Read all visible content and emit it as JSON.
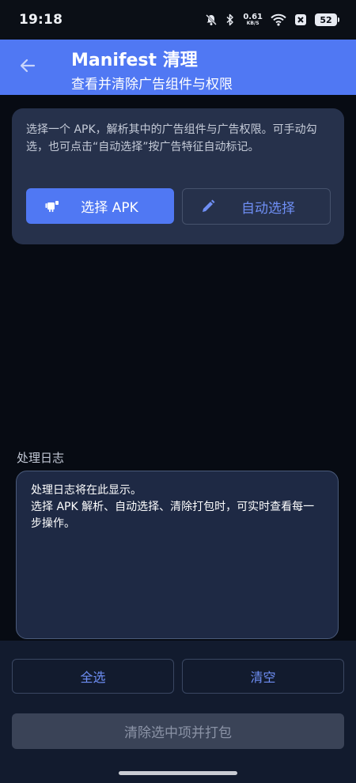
{
  "status_bar": {
    "time": "19:18",
    "net_speed_value": "0.61",
    "net_speed_unit": "KB/S",
    "battery_level": "52",
    "icons": [
      "bell-off-icon",
      "bluetooth-icon",
      "wifi-icon",
      "x-app-icon",
      "battery-icon"
    ]
  },
  "app_bar": {
    "back_icon": "arrow-left-icon",
    "title": "Manifest 清理",
    "subtitle": "查看并清除广告组件与权限"
  },
  "intro_card": {
    "description": "选择一个 APK，解析其中的广告组件与广告权限。可手动勾选，也可点击“自动选择”按广告特征自动标记。",
    "select_apk_button": {
      "label": "选择 APK",
      "icon": "android-icon"
    },
    "auto_select_button": {
      "label": "自动选择",
      "icon": "pencil-icon"
    }
  },
  "log": {
    "title": "处理日志",
    "content": "处理日志将在此显示。\n选择 APK 解析、自动选择、清除打包时，可实时查看每一步操作。"
  },
  "bottom_actions": {
    "select_all_label": "全选",
    "clear_label": "清空",
    "clean_pack_label": "清除选中项并打包",
    "clean_pack_enabled": false
  },
  "colors": {
    "accent": "#5078f3",
    "background": "#070b13",
    "card": "#26314b",
    "bottom_panel": "#121b2e",
    "disabled_button": "#3a4357"
  }
}
